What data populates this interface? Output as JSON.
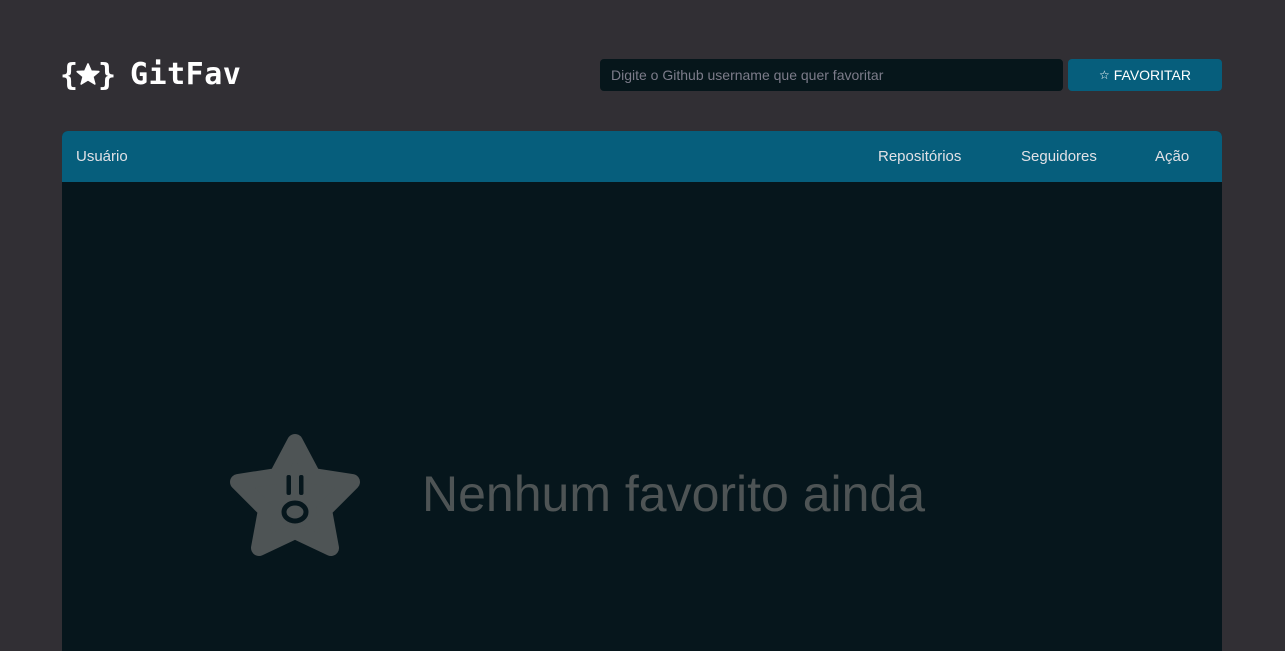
{
  "header": {
    "logo_text": "GitFav",
    "search": {
      "placeholder": "Digite o Github username que quer favoritar",
      "value": ""
    },
    "favorite_button": {
      "icon": "star-icon",
      "label": "FAVORITAR"
    }
  },
  "table": {
    "columns": [
      "Usuário",
      "Repositórios",
      "Seguidores",
      "Ação"
    ],
    "rows": []
  },
  "empty_state": {
    "icon": "surprised-star-icon",
    "message": "Nenhum favorito ainda"
  },
  "colors": {
    "page_background": "#312f34",
    "accent": "#065e7c",
    "table_background": "#06161c",
    "input_background": "#06161b",
    "empty_text": "#4e5455"
  }
}
